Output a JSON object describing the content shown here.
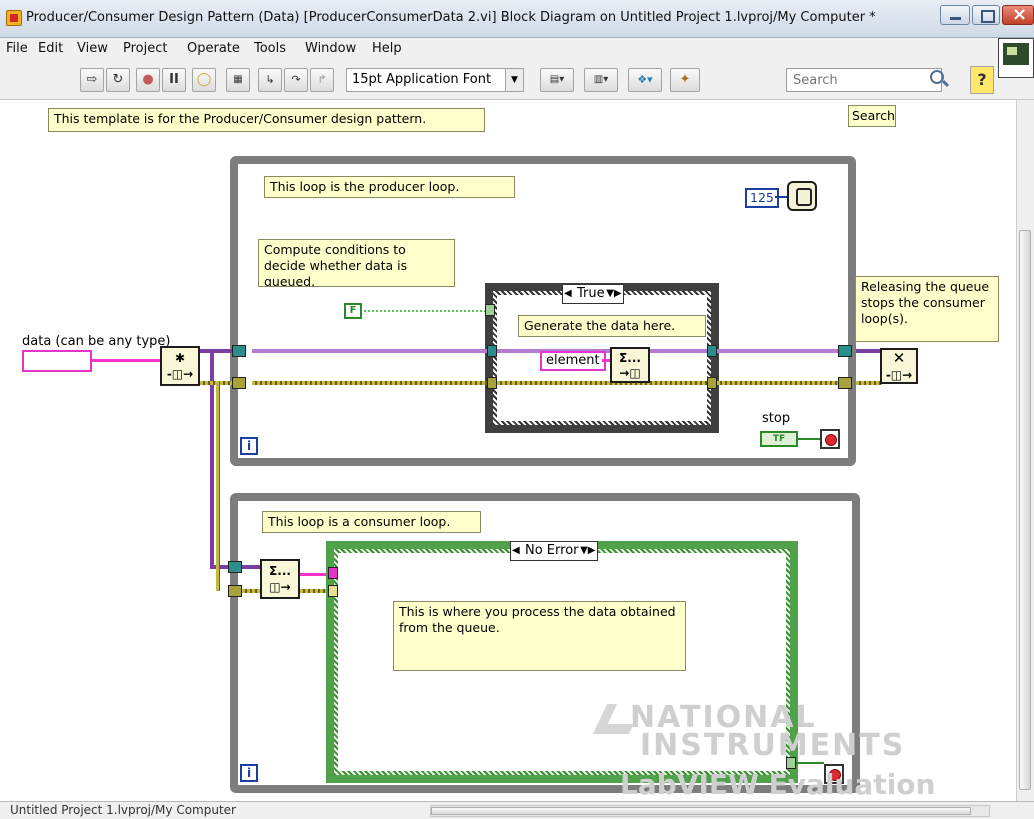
{
  "window": {
    "title": "Producer/Consumer Design Pattern (Data) [ProducerConsumerData 2.vi] Block Diagram on Untitled Project 1.lvproj/My Computer *"
  },
  "menu": {
    "items": [
      "File",
      "Edit",
      "View",
      "Project",
      "Operate",
      "Tools",
      "Window",
      "Help"
    ]
  },
  "toolbar": {
    "font_selector": "15pt Application Font",
    "search_placeholder": "Search",
    "buttons": [
      "run-arrow-icon",
      "run-continuous-icon",
      "abort-icon",
      "pause-icon",
      "highlight-execution-icon",
      "retain-wire-values-icon",
      "step-into-icon",
      "step-over-icon",
      "step-out-icon",
      "align-objects-icon",
      "distribute-objects-icon",
      "reorder-icon",
      "cleanup-diagram-icon"
    ]
  },
  "diagram": {
    "search_label": "Search",
    "comments": {
      "template": "This template is for the Producer/Consumer design pattern.",
      "producer_loop": "This loop is the producer loop.",
      "compute_conditions": "Compute conditions to decide whether data is queued.",
      "generate_data": "Generate the data here.",
      "releasing_queue": "Releasing the queue stops the consumer loop(s).",
      "consumer_loop": "This loop is a consumer loop.",
      "process_data": "This is where you process the data obtained from the queue."
    },
    "labels": {
      "data_control": "data (can be any type)",
      "element": "element",
      "stop": "stop",
      "wait_ms": "125",
      "bool_false": "F",
      "tf": "TF",
      "iteration": "i"
    },
    "case_selectors": {
      "producer": "True",
      "consumer": "No Error"
    },
    "watermark": {
      "brand_line1": "NATIONAL",
      "brand_line2": "INSTRUMENTS",
      "product": "LabVIEW  Evaluation Software"
    }
  },
  "statusbar": {
    "path": "Untitled Project 1.lvproj/My Computer"
  },
  "colors": {
    "wire_queue": "#7b3ea3",
    "wire_error": "#c3ba3e",
    "comment_bg": "#ffffcc",
    "loop_frame": "#7d7d7d",
    "consumer_case_border": "#4fa24a",
    "string_pink": "#e633cc"
  }
}
